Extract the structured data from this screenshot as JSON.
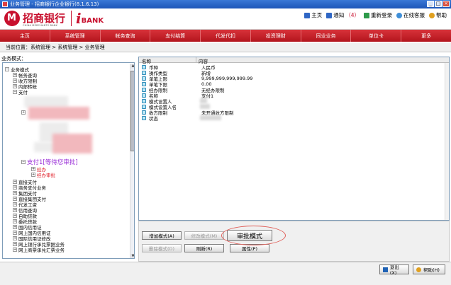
{
  "window": {
    "title": "业务管理 - 招商银行企业银行(8.1.6.13)"
  },
  "brand": {
    "cn": "招商银行",
    "en": "CHINA MERCHANTS BANK",
    "ibank_i": "i",
    "ibank_text": "BANK"
  },
  "toplinks": {
    "home": "主页",
    "notify": "通知",
    "notify_count": "（4）",
    "relogin": "重新登录",
    "online": "在线客服",
    "help": "帮助"
  },
  "nav": [
    "主页",
    "系统管理",
    "帐务查询",
    "支付结算",
    "代发代扣",
    "投资理财",
    "同业业务",
    "单位卡",
    "更多"
  ],
  "breadcrumb": "当前位置：系统管理 > 系统管理 > 业务管理",
  "left": {
    "label": "业务模式："
  },
  "tree": {
    "root": "业务模式",
    "n1": "帐务查询",
    "n2": "收方限制",
    "n3": "内部转帐",
    "n4": "支付",
    "pending": "支付1[等待您审批]",
    "pend_child1": "经办",
    "pend_child2": "经办审批",
    "items": [
      "直接支付",
      "商务支付业务",
      "集团支付",
      "直接集团支付",
      "代发工资",
      "信用查询",
      "自助贷款",
      "委托贷款",
      "国内信用证",
      "网上国内信用证",
      "国际信用证修改",
      "网上银行承兑票据业务",
      "网上商票承兑汇票业务"
    ]
  },
  "grid": {
    "col_name": "名称",
    "col_value": "内容",
    "rows": [
      {
        "name": "币种",
        "value": "人民币"
      },
      {
        "name": "操作类型",
        "value": "新增"
      },
      {
        "name": "单笔上限",
        "value": "9,999,999,999,999.99"
      },
      {
        "name": "单笔下限",
        "value": "0.00"
      },
      {
        "name": "经办限制",
        "value": "无经办限制"
      },
      {
        "name": "名称",
        "value": "支付1"
      },
      {
        "name": "模式设置人",
        "value": ""
      },
      {
        "name": "模式设置人名",
        "value": ""
      },
      {
        "name": "收方限制",
        "value": "未开通收方限制"
      },
      {
        "name": "状态",
        "value": ""
      }
    ]
  },
  "buttons": {
    "add": "增加模式(A)",
    "modify": "修改模式(M)",
    "approve": "审批模式",
    "delete": "删除模式(D)",
    "refresh": "刷新(R)",
    "property": "属性(P)"
  },
  "bottom": {
    "exit": "退出(X)",
    "help": "帮助(H)"
  },
  "colors": {
    "nav_red": "#c8102e",
    "pending_purple": "#9b30d8",
    "highlight_ellipse": "#e0605a"
  }
}
